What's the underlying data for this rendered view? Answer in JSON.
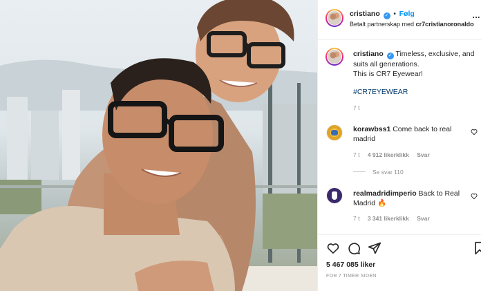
{
  "post": {
    "username": "cristiano",
    "follow_label": "Følg",
    "separator": "•",
    "partnership_prefix": "Betalt partnerskap med",
    "partner": "cr7cristianoronaldo",
    "more_label": "..."
  },
  "caption": {
    "username": "cristiano",
    "line1": "Timeless, exclusive, and",
    "line2": "suits all generations.",
    "line3": "This is CR7 Eyewear!",
    "hashtag": "#CR7EYEWEAR",
    "time": "7 t"
  },
  "comments": [
    {
      "username": "korawbss1",
      "text": "Come back to real madrid",
      "time": "7 t",
      "likes": "4 912 likerklikk",
      "reply": "Svar",
      "view_replies": "Se svar 110"
    },
    {
      "username": "realmadridimperio",
      "text": "Back to Real Madrid 🔥",
      "time": "7 t",
      "likes": "3 341 likerklikk",
      "reply": "Svar"
    }
  ],
  "footer": {
    "likes": "5 467 085 liker",
    "timestamp": "FOR 7 TIMER SIDEN"
  },
  "icons": {
    "like": "heart-icon",
    "comment": "comment-icon",
    "share": "paper-plane-icon",
    "save": "bookmark-icon",
    "verified": "verified-badge-icon"
  },
  "colors": {
    "link_blue": "#0095f6",
    "hashtag_blue": "#00376b",
    "muted_gray": "#8e8e8e",
    "text": "#262626"
  }
}
